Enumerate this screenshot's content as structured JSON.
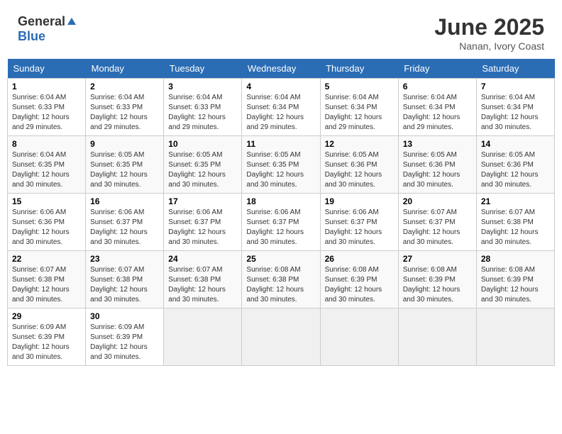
{
  "header": {
    "logo_general": "General",
    "logo_blue": "Blue",
    "month_year": "June 2025",
    "location": "Nanan, Ivory Coast"
  },
  "weekdays": [
    "Sunday",
    "Monday",
    "Tuesday",
    "Wednesday",
    "Thursday",
    "Friday",
    "Saturday"
  ],
  "weeks": [
    [
      {
        "day": "1",
        "sunrise": "6:04 AM",
        "sunset": "6:33 PM",
        "daylight": "12 hours and 29 minutes."
      },
      {
        "day": "2",
        "sunrise": "6:04 AM",
        "sunset": "6:33 PM",
        "daylight": "12 hours and 29 minutes."
      },
      {
        "day": "3",
        "sunrise": "6:04 AM",
        "sunset": "6:33 PM",
        "daylight": "12 hours and 29 minutes."
      },
      {
        "day": "4",
        "sunrise": "6:04 AM",
        "sunset": "6:34 PM",
        "daylight": "12 hours and 29 minutes."
      },
      {
        "day": "5",
        "sunrise": "6:04 AM",
        "sunset": "6:34 PM",
        "daylight": "12 hours and 29 minutes."
      },
      {
        "day": "6",
        "sunrise": "6:04 AM",
        "sunset": "6:34 PM",
        "daylight": "12 hours and 29 minutes."
      },
      {
        "day": "7",
        "sunrise": "6:04 AM",
        "sunset": "6:34 PM",
        "daylight": "12 hours and 30 minutes."
      }
    ],
    [
      {
        "day": "8",
        "sunrise": "6:04 AM",
        "sunset": "6:35 PM",
        "daylight": "12 hours and 30 minutes."
      },
      {
        "day": "9",
        "sunrise": "6:05 AM",
        "sunset": "6:35 PM",
        "daylight": "12 hours and 30 minutes."
      },
      {
        "day": "10",
        "sunrise": "6:05 AM",
        "sunset": "6:35 PM",
        "daylight": "12 hours and 30 minutes."
      },
      {
        "day": "11",
        "sunrise": "6:05 AM",
        "sunset": "6:35 PM",
        "daylight": "12 hours and 30 minutes."
      },
      {
        "day": "12",
        "sunrise": "6:05 AM",
        "sunset": "6:36 PM",
        "daylight": "12 hours and 30 minutes."
      },
      {
        "day": "13",
        "sunrise": "6:05 AM",
        "sunset": "6:36 PM",
        "daylight": "12 hours and 30 minutes."
      },
      {
        "day": "14",
        "sunrise": "6:05 AM",
        "sunset": "6:36 PM",
        "daylight": "12 hours and 30 minutes."
      }
    ],
    [
      {
        "day": "15",
        "sunrise": "6:06 AM",
        "sunset": "6:36 PM",
        "daylight": "12 hours and 30 minutes."
      },
      {
        "day": "16",
        "sunrise": "6:06 AM",
        "sunset": "6:37 PM",
        "daylight": "12 hours and 30 minutes."
      },
      {
        "day": "17",
        "sunrise": "6:06 AM",
        "sunset": "6:37 PM",
        "daylight": "12 hours and 30 minutes."
      },
      {
        "day": "18",
        "sunrise": "6:06 AM",
        "sunset": "6:37 PM",
        "daylight": "12 hours and 30 minutes."
      },
      {
        "day": "19",
        "sunrise": "6:06 AM",
        "sunset": "6:37 PM",
        "daylight": "12 hours and 30 minutes."
      },
      {
        "day": "20",
        "sunrise": "6:07 AM",
        "sunset": "6:37 PM",
        "daylight": "12 hours and 30 minutes."
      },
      {
        "day": "21",
        "sunrise": "6:07 AM",
        "sunset": "6:38 PM",
        "daylight": "12 hours and 30 minutes."
      }
    ],
    [
      {
        "day": "22",
        "sunrise": "6:07 AM",
        "sunset": "6:38 PM",
        "daylight": "12 hours and 30 minutes."
      },
      {
        "day": "23",
        "sunrise": "6:07 AM",
        "sunset": "6:38 PM",
        "daylight": "12 hours and 30 minutes."
      },
      {
        "day": "24",
        "sunrise": "6:07 AM",
        "sunset": "6:38 PM",
        "daylight": "12 hours and 30 minutes."
      },
      {
        "day": "25",
        "sunrise": "6:08 AM",
        "sunset": "6:38 PM",
        "daylight": "12 hours and 30 minutes."
      },
      {
        "day": "26",
        "sunrise": "6:08 AM",
        "sunset": "6:39 PM",
        "daylight": "12 hours and 30 minutes."
      },
      {
        "day": "27",
        "sunrise": "6:08 AM",
        "sunset": "6:39 PM",
        "daylight": "12 hours and 30 minutes."
      },
      {
        "day": "28",
        "sunrise": "6:08 AM",
        "sunset": "6:39 PM",
        "daylight": "12 hours and 30 minutes."
      }
    ],
    [
      {
        "day": "29",
        "sunrise": "6:09 AM",
        "sunset": "6:39 PM",
        "daylight": "12 hours and 30 minutes."
      },
      {
        "day": "30",
        "sunrise": "6:09 AM",
        "sunset": "6:39 PM",
        "daylight": "12 hours and 30 minutes."
      },
      null,
      null,
      null,
      null,
      null
    ]
  ]
}
